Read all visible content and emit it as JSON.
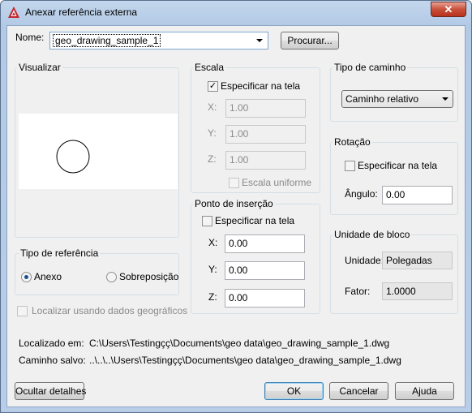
{
  "window": {
    "title": "Anexar referência externa",
    "close_glyph": "✕"
  },
  "name_row": {
    "label": "Nome:",
    "value": "geo_drawing_sample_1",
    "browse_label": "Procurar..."
  },
  "preview": {
    "title": "Visualizar"
  },
  "scale": {
    "title": "Escala",
    "specify_on_screen_label": "Especificar na tela",
    "specify_on_screen_checked": true,
    "x_label": "X:",
    "x_value": "1.00",
    "y_label": "Y:",
    "y_value": "1.00",
    "z_label": "Z:",
    "z_value": "1.00",
    "uniform_label": "Escala uniforme",
    "uniform_checked": false
  },
  "insertion_point": {
    "title": "Ponto de inserção",
    "specify_on_screen_label": "Especificar na tela",
    "specify_on_screen_checked": false,
    "x_label": "X:",
    "x_value": "0.00",
    "y_label": "Y:",
    "y_value": "0.00",
    "z_label": "Z:",
    "z_value": "0.00"
  },
  "path_type": {
    "title": "Tipo de caminho",
    "selected": "Caminho relativo"
  },
  "rotation": {
    "title": "Rotação",
    "specify_on_screen_label": "Especificar na tela",
    "specify_on_screen_checked": false,
    "angle_label": "Ângulo:",
    "angle_value": "0.00"
  },
  "block_unit": {
    "title": "Unidade de bloco",
    "unit_label": "Unidade:",
    "unit_value": "Polegadas",
    "factor_label": "Fator:",
    "factor_value": "1.0000"
  },
  "reference_type": {
    "title": "Tipo de referência",
    "attach_label": "Anexo",
    "overlay_label": "Sobreposição",
    "selected": "Anexo"
  },
  "geo_locate": {
    "label": "Localizar usando dados geográficos",
    "checked": false
  },
  "paths": {
    "found_in_label": "Localizado em:",
    "found_in_value": "C:\\Users\\Testingçç\\Documents\\geo data\\geo_drawing_sample_1.dwg",
    "saved_path_label": "Caminho salvo:",
    "saved_path_value": "..\\..\\..\\Users\\Testingçç\\Documents\\geo data\\geo_drawing_sample_1.dwg"
  },
  "buttons": {
    "hide_details": "Ocultar detalhes",
    "ok": "OK",
    "cancel": "Cancelar",
    "help": "Ajuda"
  },
  "colors": {
    "title_bar": "#b9cfe9",
    "close_button": "#c9503a",
    "selection": "#3399ff",
    "client_bg": "#f0f0f0"
  }
}
